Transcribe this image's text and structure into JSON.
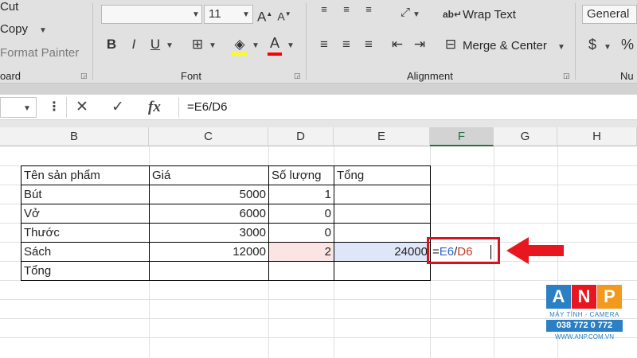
{
  "ribbon": {
    "clipboard": {
      "cut": "Cut",
      "copy": "Copy",
      "format_painter": "Format Painter",
      "group_label": "oard"
    },
    "font": {
      "font_name": "",
      "font_size": "11",
      "grow_icon": "A",
      "shrink_icon": "A",
      "bold": "B",
      "italic": "I",
      "underline": "U",
      "font_color_icon": "A",
      "group_label": "Font"
    },
    "alignment": {
      "wrap_text": "Wrap Text",
      "merge_center": "Merge & Center",
      "group_label": "Alignment"
    },
    "number": {
      "format": "General",
      "currency": "$",
      "percent": "%",
      "group_label": "Nu"
    }
  },
  "formula_bar": {
    "cancel_icon": "✕",
    "enter_icon": "✓",
    "fx": "fx",
    "formula": "=E6/D6"
  },
  "columns": [
    "B",
    "C",
    "D",
    "E",
    "F",
    "G",
    "H"
  ],
  "selected_column": "F",
  "table": {
    "header": [
      "Tên sản phẩm",
      "Giá",
      "Số lượng",
      "Tổng"
    ],
    "rows": [
      {
        "name": "Bút",
        "price": "5000",
        "qty": "1",
        "total": ""
      },
      {
        "name": "Vở",
        "price": "6000",
        "qty": "0",
        "total": ""
      },
      {
        "name": "Thước",
        "price": "3000",
        "qty": "0",
        "total": ""
      },
      {
        "name": "Sách",
        "price": "12000",
        "qty": "2",
        "total": "24000"
      },
      {
        "name": "Tổng",
        "price": "",
        "qty": "",
        "total": ""
      }
    ]
  },
  "active_cell": {
    "eq": "=",
    "ref1": "E6",
    "slash": "/",
    "ref2": "D6"
  },
  "colors": {
    "accent": "#217346",
    "arrow": "#e8161e",
    "ref1": "#2f62c8",
    "ref2": "#c0392b",
    "logo_a": "#2a7fc5",
    "logo_n": "#e8161e",
    "logo_p": "#f29a1f"
  },
  "logo": {
    "letters": [
      "A",
      "N",
      "P"
    ],
    "tagline": "MÁY TÍNH - CAMERA",
    "phone": "038 772 0 772",
    "website": "WWW.ANP.COM.VN"
  }
}
